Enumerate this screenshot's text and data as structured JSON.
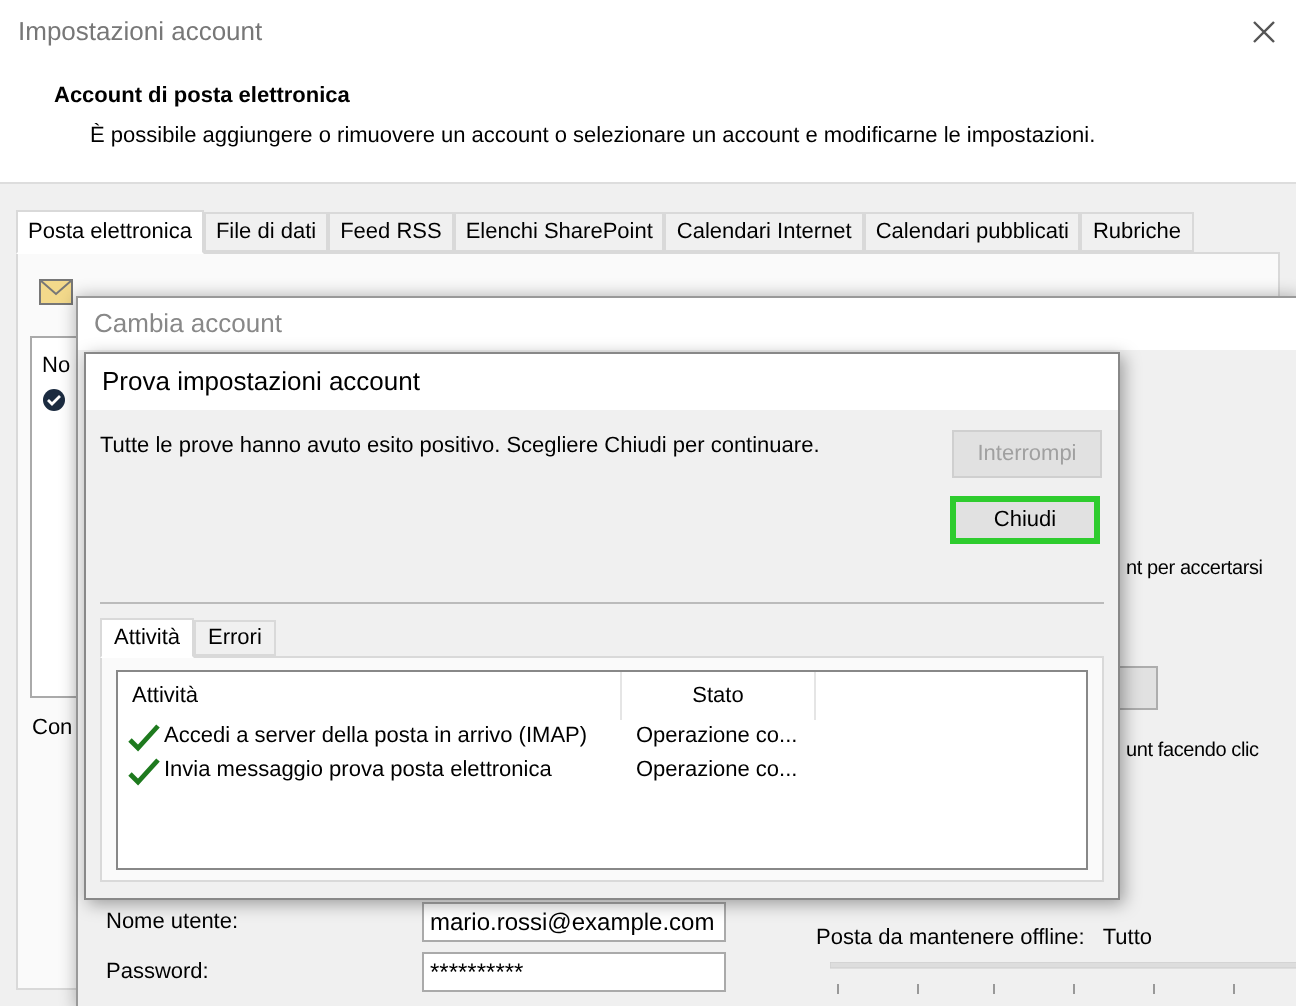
{
  "settings_window": {
    "title": "Impostazioni account",
    "heading": "Account di posta elettronica",
    "description": "È possibile aggiungere o rimuovere un account o selezionare un account e modificarne le impostazioni.",
    "tabs": [
      {
        "label": "Posta elettronica",
        "selected": true
      },
      {
        "label": "File di dati",
        "selected": false
      },
      {
        "label": "Feed RSS",
        "selected": false
      },
      {
        "label": "Elenchi SharePoint",
        "selected": false
      },
      {
        "label": "Calendari Internet",
        "selected": false
      },
      {
        "label": "Calendari pubblicati",
        "selected": false
      },
      {
        "label": "Rubriche",
        "selected": false
      }
    ],
    "list_header_fragment": "No",
    "footer_fragment": "Con"
  },
  "change_account_window": {
    "title": "Cambia account",
    "text_fragment_1": "nt per accertarsi",
    "text_fragment_2": "unt facendo clic",
    "username_label": "Nome utente:",
    "username_value": "mario.rossi@example.com",
    "password_label": "Password:",
    "password_value": "**********",
    "offline_label": "Posta da mantenere offline:",
    "offline_value": "Tutto"
  },
  "test_dialog": {
    "title": "Prova impostazioni account",
    "message": "Tutte le prove hanno avuto esito positivo. Scegliere Chiudi per continuare.",
    "buttons": [
      {
        "label": "Interrompi",
        "disabled": true,
        "focused": false
      },
      {
        "label": "Chiudi",
        "disabled": false,
        "focused": true
      }
    ],
    "tabs": [
      {
        "label": "Attività",
        "selected": true
      },
      {
        "label": "Errori",
        "selected": false
      }
    ],
    "columns": [
      "Attività",
      "Stato"
    ],
    "rows": [
      {
        "task": "Accedi a server della posta in arrivo (IMAP)",
        "status": "Operazione co...",
        "done": true
      },
      {
        "task": "Invia messaggio prova posta elettronica",
        "status": "Operazione co...",
        "done": true
      }
    ]
  }
}
